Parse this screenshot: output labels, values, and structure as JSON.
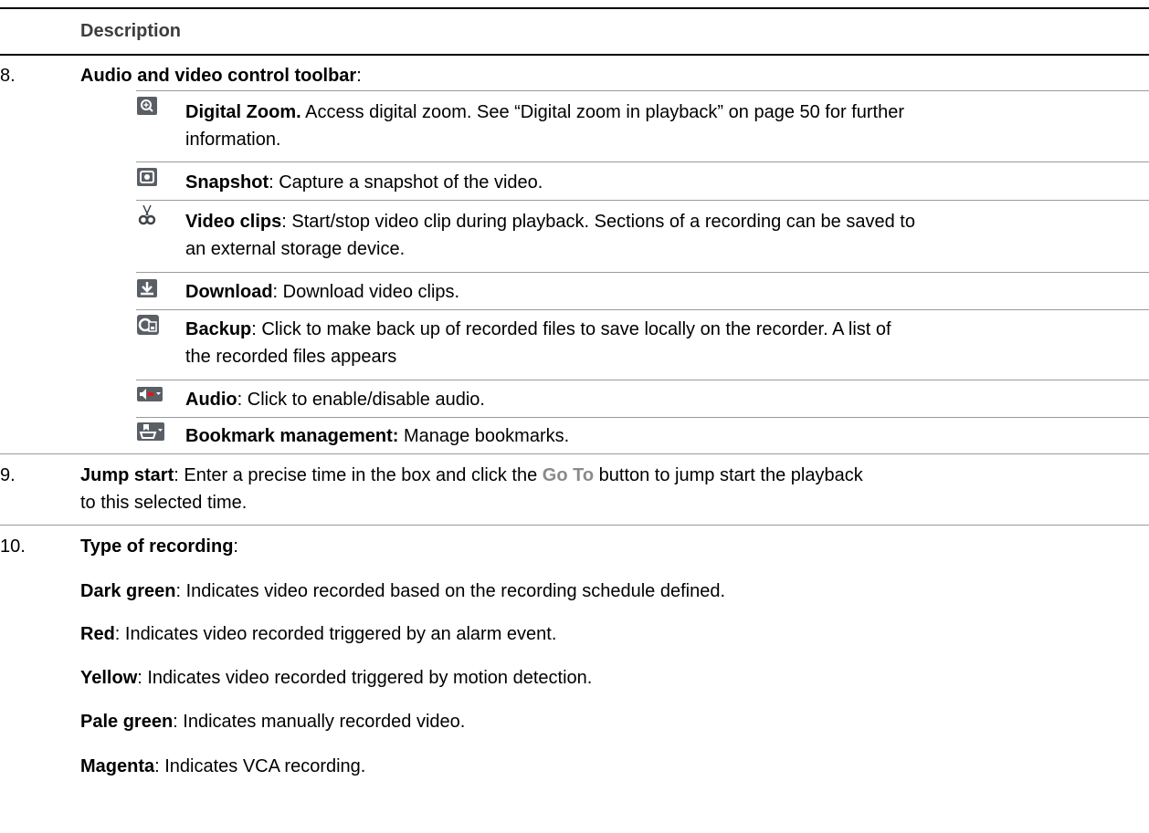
{
  "header": {
    "description": "Description"
  },
  "rows": {
    "r8": {
      "number": "8.",
      "title": "Audio and video control toolbar",
      "colon": ":"
    },
    "toolbar": [
      {
        "icon": "zoom-in-icon",
        "title": "Digital Zoom.",
        "text": " Access digital zoom. See “Digital zoom in playback” on page 50 for further",
        "text2": "information."
      },
      {
        "icon": "camera-icon",
        "title": "Snapshot",
        "text": ": Capture a snapshot of the video."
      },
      {
        "icon": "scissors-icon",
        "title": "Video clips",
        "text": ": Start/stop video clip during playback. Sections of a recording can be saved to",
        "text2": "an external storage device."
      },
      {
        "icon": "download-icon",
        "title": "Download",
        "text": ": Download video clips."
      },
      {
        "icon": "backup-icon",
        "title": "Backup",
        "text": ": Click to make back up of recorded files to save locally on the recorder. A list of",
        "text2": "the recorded files appears"
      },
      {
        "icon": "audio-icon",
        "title": "Audio",
        "text": ": Click to enable/disable audio."
      },
      {
        "icon": "bookmark-icon",
        "title": "Bookmark management:",
        "text": " Manage bookmarks."
      }
    ],
    "r9": {
      "number": "9.",
      "title": "Jump start",
      "text_a": ": Enter a precise time in the box and click the ",
      "goto": "Go To",
      "text_b": " button to jump start the playback",
      "text2": "to this selected time."
    },
    "r10": {
      "number": "10.",
      "title": "Type of recording",
      "colon": ":"
    },
    "types": [
      {
        "label": "Dark green",
        "text": ": Indicates video recorded based on the recording schedule defined."
      },
      {
        "label": "Red",
        "text": ": Indicates video recorded triggered by an alarm event."
      },
      {
        "label": "Yellow",
        "text": ": Indicates video recorded triggered by motion detection."
      },
      {
        "label": "Pale green",
        "text": ": Indicates manually recorded video."
      },
      {
        "label": "Magenta",
        "text": ": Indicates VCA recording."
      }
    ]
  }
}
